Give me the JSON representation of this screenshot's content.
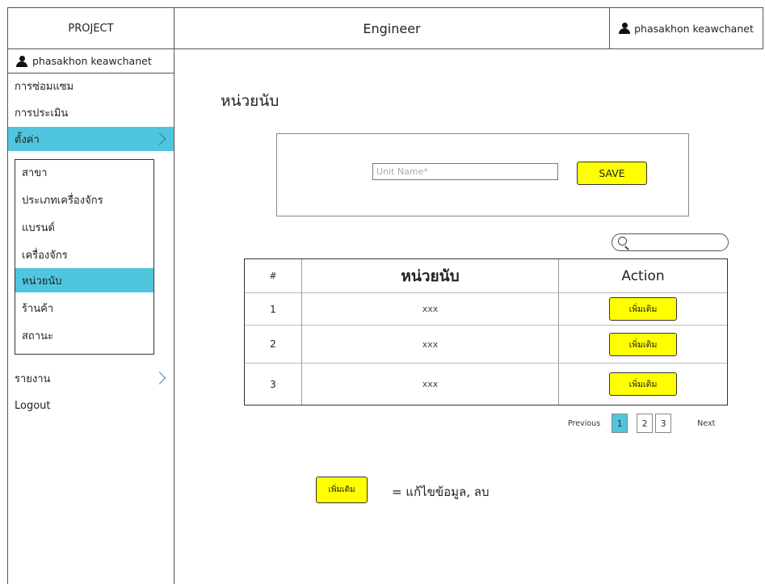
{
  "header": {
    "project_label": "PROJECT",
    "center_title": "Engineer",
    "user_name": "phasakhon keawchanet"
  },
  "sidebar": {
    "user_name": "phasakhon keawchanet",
    "items": [
      {
        "label": "การซ่อมแซม",
        "active": false
      },
      {
        "label": "การประเมิน",
        "active": false
      },
      {
        "label": "ตั้งค่า",
        "active": true,
        "has_chevron": true
      },
      {
        "label": "รายงาน",
        "active": false,
        "has_chevron": true
      },
      {
        "label": "Logout",
        "active": false
      }
    ],
    "submenu": [
      {
        "label": "สาขา",
        "active": false
      },
      {
        "label": "ประเภทเครื่องจักร",
        "active": false
      },
      {
        "label": "แบรนด์",
        "active": false
      },
      {
        "label": "เครื่องจักร",
        "active": false
      },
      {
        "label": "หน่วยนับ",
        "active": true
      },
      {
        "label": "ร้านค้า",
        "active": false
      },
      {
        "label": "สถานะ",
        "active": false
      }
    ]
  },
  "main": {
    "page_title": "หน่วยนับ",
    "form": {
      "unit_placeholder": "Unit Name*",
      "save_label": "SAVE"
    },
    "table": {
      "headers": [
        "#",
        "หน่วยนับ",
        "Action"
      ],
      "rows": [
        {
          "num": "1",
          "unit": "xxx",
          "action": "เพิ่มเติม"
        },
        {
          "num": "2",
          "unit": "xxx",
          "action": "เพิ่มเติม"
        },
        {
          "num": "3",
          "unit": "xxx",
          "action": "เพิ่มเติม"
        }
      ]
    },
    "pagination": {
      "previous": "Previous",
      "pages": [
        "1",
        "2",
        "3"
      ],
      "current": "1",
      "next": "Next"
    },
    "legend": {
      "button_label": "เพิ่มเติม",
      "text": "=  แก้ไขข้อมูล, ลบ"
    }
  },
  "colors": {
    "accent": "#4fc6de",
    "button_yellow": "#ffff00"
  }
}
